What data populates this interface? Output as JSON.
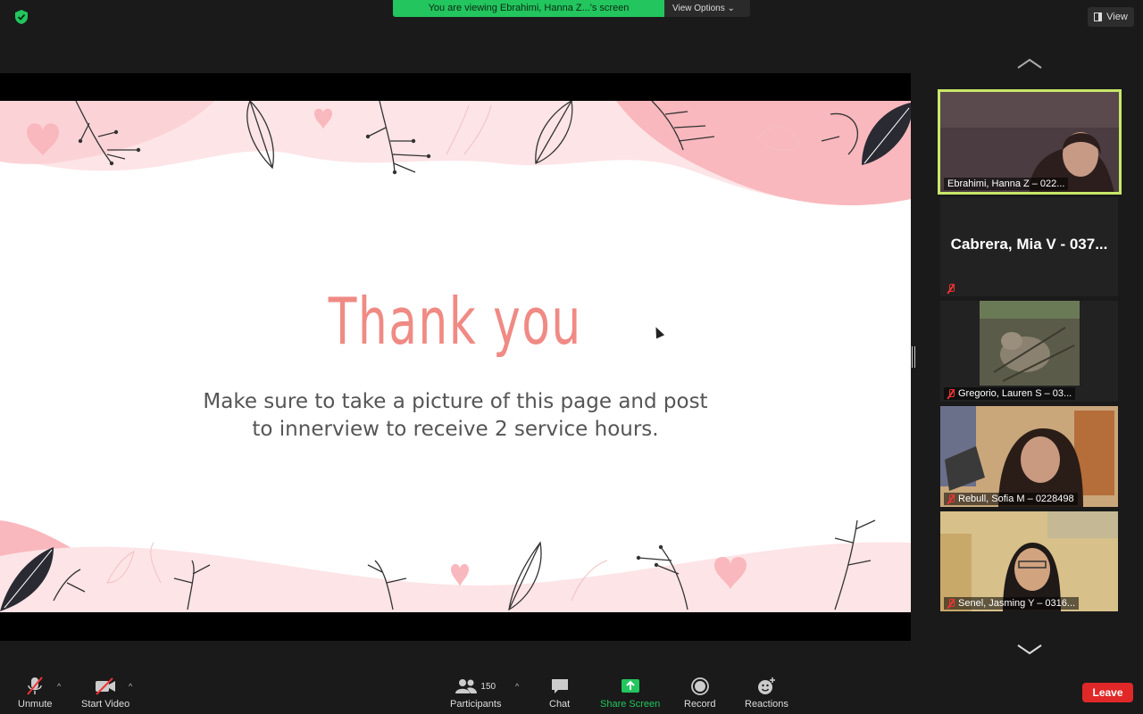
{
  "banner": {
    "text": "You are viewing Ebrahimi, Hanna Z...'s screen",
    "options": "View Options"
  },
  "view_button": "View",
  "slide": {
    "title": "Thank you",
    "body_line1": "Make sure to take a picture of this page and post",
    "body_line2": "to innerview to receive 2 service hours."
  },
  "participants": [
    {
      "name": "Ebrahimi, Hanna Z – 022...",
      "active": true
    },
    {
      "name": "Cabrera, Mia V - 037...",
      "muted": true
    },
    {
      "name": "Gregorio, Lauren S – 03...",
      "muted": true
    },
    {
      "name": "Rebull, Sofia M – 0228498",
      "muted": true
    },
    {
      "name": "Senel, Jasming Y – 0316...",
      "muted": true
    }
  ],
  "toolbar": {
    "unmute": "Unmute",
    "start_video": "Start Video",
    "participants_count": "150",
    "participants": "Participants",
    "chat": "Chat",
    "share_screen": "Share Screen",
    "record": "Record",
    "reactions": "Reactions",
    "leave": "Leave"
  },
  "colors": {
    "accent_green": "#22c55e",
    "leave_red": "#e02828",
    "active_border": "#c8e86a",
    "slide_pink": "#f08a84"
  }
}
